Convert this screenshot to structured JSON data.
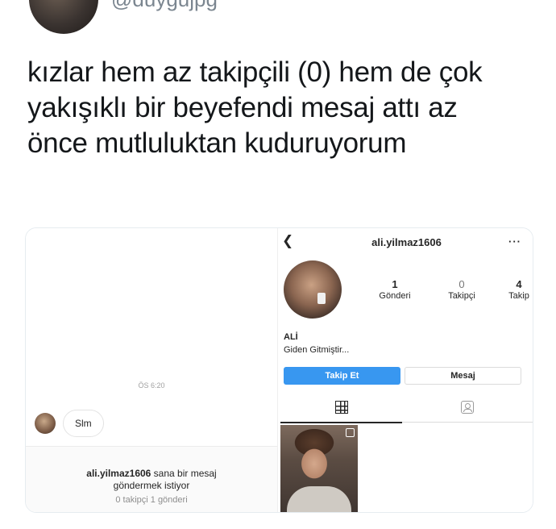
{
  "tweet": {
    "handle": "@duygujpg",
    "text_lines": [
      "kızlar hem az takipçili (0) hem de çok",
      "yakışıklı bir beyefendi mesaj attı az",
      "önce mutluluktan kuduruyorum"
    ]
  },
  "dm": {
    "timestamp": "ÖS 6:20",
    "message": "Slm",
    "request": {
      "username": "ali.yilmaz1606",
      "text_after_username": " sana bir mesaj",
      "text_line2": "göndermek istiyor",
      "meta": "0 takipçi 1 gönderi"
    }
  },
  "profile": {
    "back_icon": "chevron-left-icon",
    "username": "ali.yilmaz1606",
    "more_icon": "more-dots-icon",
    "stats": [
      {
        "num": "1",
        "label": "Gönderi"
      },
      {
        "num": "0",
        "label": "Takipçi"
      },
      {
        "num": "4",
        "label": "Takip"
      }
    ],
    "name": "ALİ",
    "bio": "Giden Gitmiştir...",
    "follow_label": "Takip Et",
    "message_label": "Mesaj",
    "follow_color": "#3897f0",
    "tabs": [
      "grid-icon",
      "tagged-icon"
    ]
  }
}
